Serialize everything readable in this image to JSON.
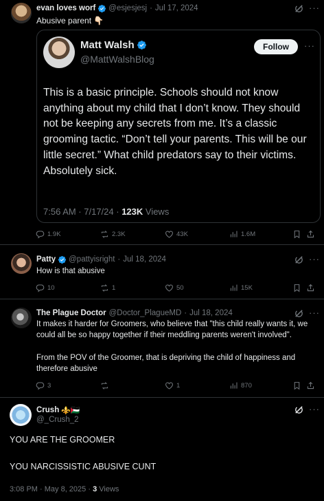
{
  "tweet1": {
    "name": "evan loves worf",
    "handle": "@esjesjesj",
    "sep": "·",
    "date": "Jul 17, 2024",
    "text": "Abusive parent 👇🏻",
    "quote": {
      "name": "Matt Walsh",
      "handle": "@MattWalshBlog",
      "follow_label": "Follow",
      "text": "This is a basic principle. Schools should not know anything about my child that I don’t know. They should not be keeping any secrets from me. It’s a classic grooming tactic. “Don’t tell your parents. This will be our little secret.” What child predators say to their victims. Absolutely sick.",
      "time": "7:56 AM · 7/17/24 · ",
      "views_count": "123K",
      "views_label": " Views"
    },
    "stats": {
      "replies": "1.9K",
      "reposts": "2.3K",
      "likes": "43K",
      "views": "1.6M"
    }
  },
  "tweet2": {
    "name": "Patty",
    "handle": "@pattyisright",
    "sep": "·",
    "date": "Jul 18, 2024",
    "text": "How is that abusive",
    "stats": {
      "replies": "10",
      "reposts": "1",
      "likes": "50",
      "views": "15K"
    }
  },
  "tweet3": {
    "name": "The Plague Doctor",
    "handle": "@Doctor_PlagueMD",
    "sep": "·",
    "date": "Jul 18, 2024",
    "text1": "It makes it harder for Groomers, who believe that \"this child really wants it, we could all be so happy together if their meddling parents weren't involved\".",
    "text2": "From the POV of the Groomer, that is depriving the child of happiness and therefore abusive",
    "stats": {
      "replies": "3",
      "reposts": "",
      "likes": "1",
      "views": "870"
    }
  },
  "main": {
    "name": "Crush",
    "name_emoji": "⚜️🇵🇸",
    "handle": "@_Crush_2",
    "line1": "YOU ARE THE GROOMER",
    "line2": "YOU NARCISSISTIC ABUSIVE CUNT",
    "time": "3:08 PM · May 8, 2025 · ",
    "views_count": "3",
    "views_label": " Views"
  },
  "colors": {
    "accent": "#1d9bf0",
    "muted": "#71767b",
    "text": "#e7e9ea",
    "border": "#2f3336"
  }
}
